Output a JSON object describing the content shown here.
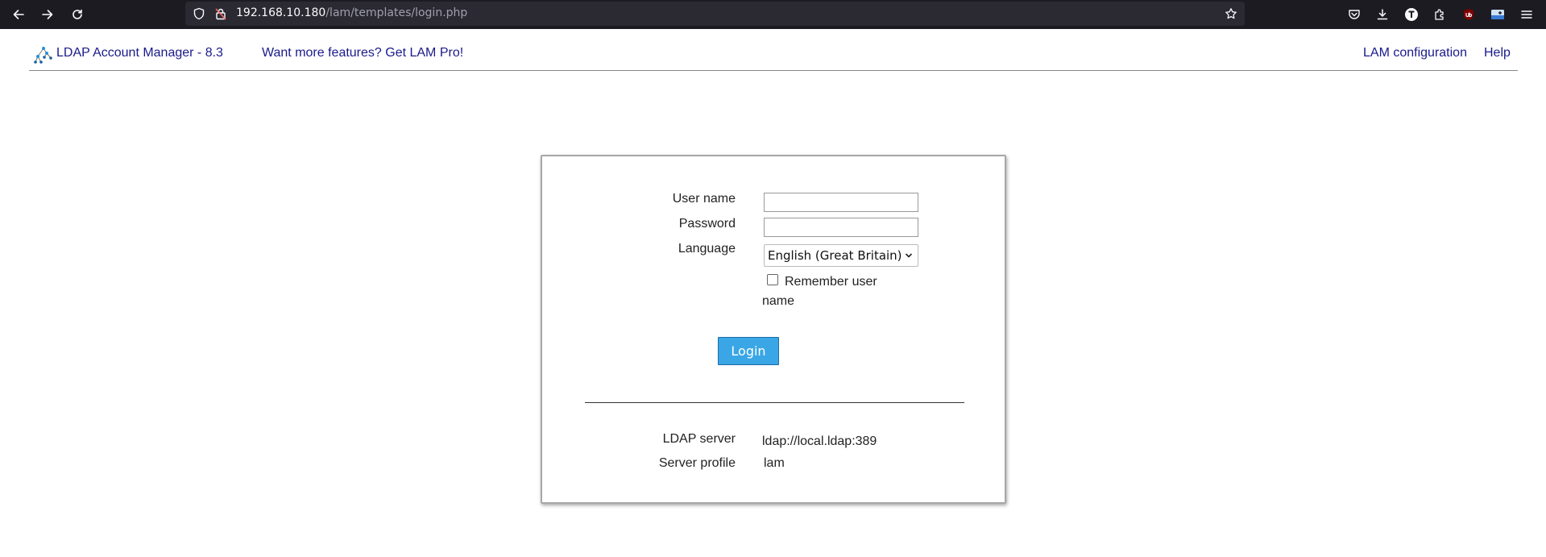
{
  "browser": {
    "url_host": "192.168.10.180",
    "url_path": "/lam/templates/login.php"
  },
  "header": {
    "app_title": "LDAP Account Manager - 8.3",
    "promo_link": "Want more features? Get LAM Pro!",
    "config_link": "LAM configuration",
    "help_link": "Help"
  },
  "login": {
    "username_label": "User name",
    "username_value": "",
    "password_label": "Password",
    "password_value": "",
    "language_label": "Language",
    "language_value": "English (Great Britain)",
    "remember_label": "Remember user name",
    "remember_checked": false,
    "login_button": "Login"
  },
  "server_info": {
    "ldap_server_label": "LDAP server",
    "ldap_server_value": "ldap://local.ldap:389",
    "server_profile_label": "Server profile",
    "server_profile_value": "lam"
  },
  "colors": {
    "link": "#1a1a8c",
    "login_button": "#3aa6e6",
    "chrome_bg": "#1c1b22"
  }
}
